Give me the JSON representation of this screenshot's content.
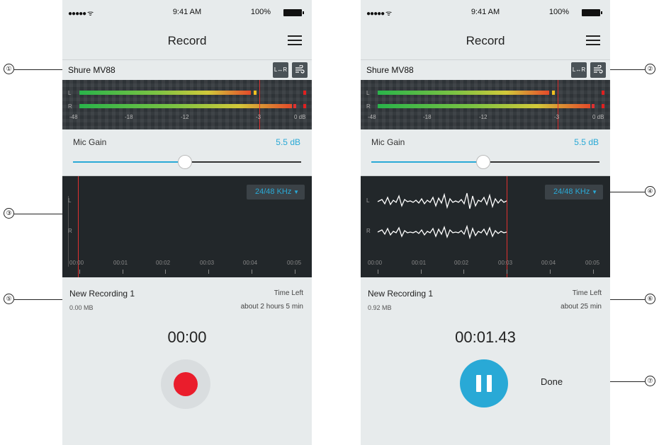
{
  "status_bar": {
    "carrier": "●●●●● ᯤ",
    "time": "9:41 AM",
    "battery": "100%"
  },
  "header": {
    "title": "Record"
  },
  "device": {
    "name": "Shure MV88",
    "lr_button": "L↔R"
  },
  "meter": {
    "left_label": "L",
    "right_label": "R",
    "scale": [
      "-48",
      "-18",
      "-12",
      "-3",
      "0 dB"
    ]
  },
  "gain": {
    "label": "Mic Gain",
    "value": "5.5 dB",
    "level": 0.49
  },
  "waveform": {
    "left_label": "L",
    "right_label": "R",
    "sample_rate": "24/48 KHz",
    "ticks": [
      "00:00",
      "00:01",
      "00:02",
      "00:03",
      "00:04",
      "00:05"
    ]
  },
  "left_screen": {
    "recording_name": "New Recording 1",
    "size": "0.00 MB",
    "time_left_label": "Time Left",
    "time_left": "about 2 hours 5 min",
    "timer": "00:00"
  },
  "right_screen": {
    "recording_name": "New Recording 1",
    "size": "0.92 MB",
    "time_left_label": "Time Left",
    "time_left": "about 25 min",
    "timer": "00:01.43",
    "done_label": "Done"
  },
  "callouts": [
    "①",
    "②",
    "③",
    "④",
    "⑤",
    "⑥",
    "⑦"
  ],
  "colors": {
    "accent": "#29a9d6",
    "record": "#ea1d2c",
    "panel": "#e7ebec",
    "dark": "#22272a"
  }
}
